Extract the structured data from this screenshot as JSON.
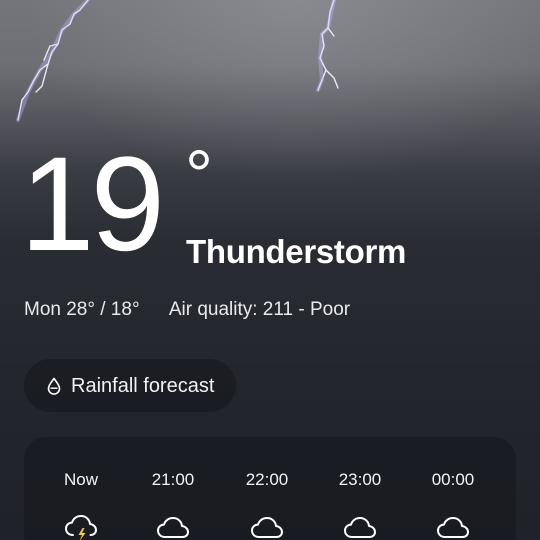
{
  "current": {
    "temperature": "19",
    "degree_symbol": "°",
    "condition": "Thunderstorm",
    "high_low": "Mon 28° / 18°",
    "air_quality": "Air quality: 211 - Poor"
  },
  "rainfall_button": {
    "label": "Rainfall forecast",
    "icon": "droplet-icon"
  },
  "hourly": [
    {
      "time": "Now",
      "icon": "thunderstorm-icon"
    },
    {
      "time": "21:00",
      "icon": "cloud-icon"
    },
    {
      "time": "22:00",
      "icon": "cloud-icon"
    },
    {
      "time": "23:00",
      "icon": "cloud-icon"
    },
    {
      "time": "00:00",
      "icon": "cloud-icon"
    }
  ],
  "colors": {
    "text": "#ffffff",
    "lightning": "#e6e4ff",
    "bolt": "#f2c94c"
  }
}
